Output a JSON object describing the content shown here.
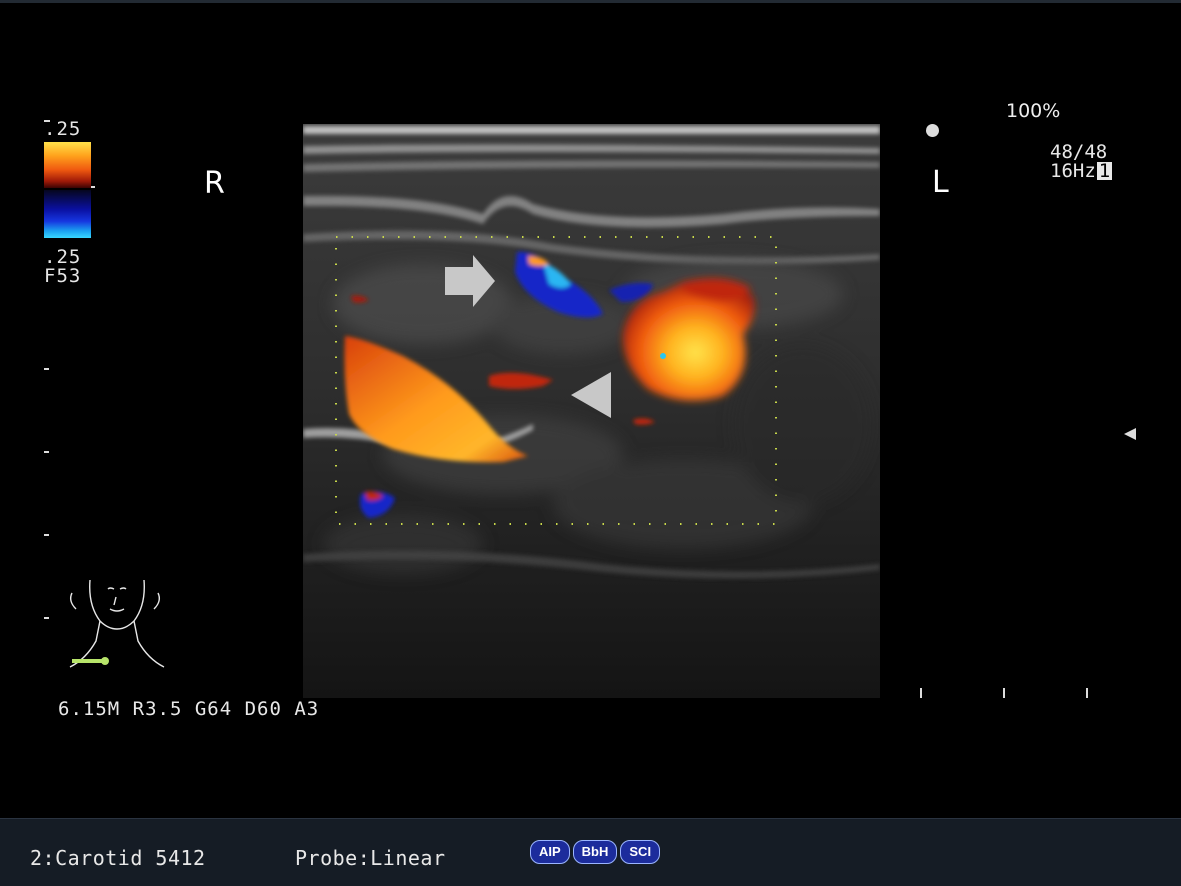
{
  "colorbar": {
    "top_value": ".25",
    "bottom_value": ".25",
    "freq_label": "F53"
  },
  "orientation": {
    "right": "R",
    "left": "L"
  },
  "top_right": {
    "power": "100%",
    "frames": "48/48",
    "frame_rate": "16Hz",
    "frame_rate_box": "1"
  },
  "parameters": "6.15M R3.5 G64 D60 A3",
  "status": {
    "preset": "2:Carotid 5412",
    "probe": "Probe:Linear",
    "buttons": [
      "AIP",
      "BbH",
      "SCI"
    ]
  },
  "icons": {
    "annotation_arrow": "arrow-right-icon",
    "annotation_arrowhead": "arrowhead-left-icon",
    "body_mark": "neck-bodymark-icon",
    "focus_marker": "focus-triangle-icon"
  },
  "colors": {
    "warm_flow": "#ff8a1c",
    "cold_flow": "#1636e0",
    "status_bar": "#151c25",
    "pill": "#1c2c9c"
  }
}
